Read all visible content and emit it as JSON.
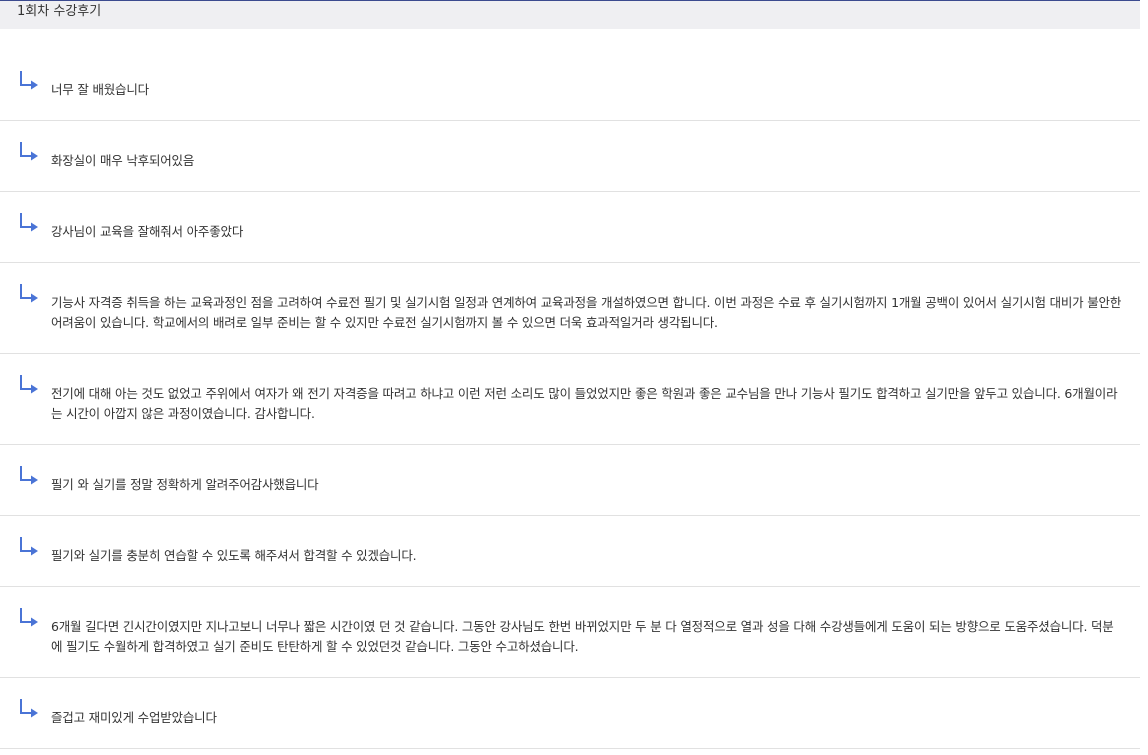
{
  "header": {
    "title": "1회차 수강후기"
  },
  "icons": {
    "reply": "reply-arrow-icon",
    "accent_color": "#4a74d6"
  },
  "reviews": [
    {
      "text": "너무 잘 배웠습니다"
    },
    {
      "text": "화장실이 매우 낙후되어있음"
    },
    {
      "text": "강사님이 교육을 잘해줘서 아주좋았다"
    },
    {
      "text": "기능사 자격증 취득을 하는 교육과정인 점을 고려하여 수료전 필기 및 실기시험 일정과 연계하여 교육과정을 개설하였으면 합니다. 이번 과정은 수료 후 실기시험까지 1개월 공백이 있어서 실기시험 대비가 불안한 어려움이 있습니다. 학교에서의 배려로 일부 준비는 할 수 있지만 수료전 실기시험까지 볼 수 있으면 더욱 효과적일거라 생각됩니다."
    },
    {
      "text": "전기에 대해 아는 것도 없었고 주위에서 여자가 왜 전기 자격증을 따려고 하냐고 이런 저런 소리도 많이 들었었지만 좋은 학원과 좋은 교수님을 만나 기능사 필기도 합격하고 실기만을 앞두고 있습니다. 6개월이라는 시간이 아깝지 않은 과정이였습니다. 감사합니다."
    },
    {
      "text": "필기 와 실기를 정말 정확하게 알려주어감사했읍니다"
    },
    {
      "text": "필기와 실기를 충분히 연습할 수 있도록 해주셔서 합격할 수 있겠습니다."
    },
    {
      "text": "6개월 길다면 긴시간이였지만 지나고보니 너무나 짧은 시간이였 던 것 같습니다. 그동안 강사님도 한번 바뀌었지만 두 분 다 열정적으로 열과 성을 다해 수강생들에게 도움이 되는 방향으로 도움주셨습니다. 덕분에 필기도 수월하게 합격하였고 실기 준비도 탄탄하게 할 수 있었던것 같습니다. 그동안 수고하셨습니다."
    },
    {
      "text": "즐겁고 재미있게 수업받았습니다"
    }
  ]
}
